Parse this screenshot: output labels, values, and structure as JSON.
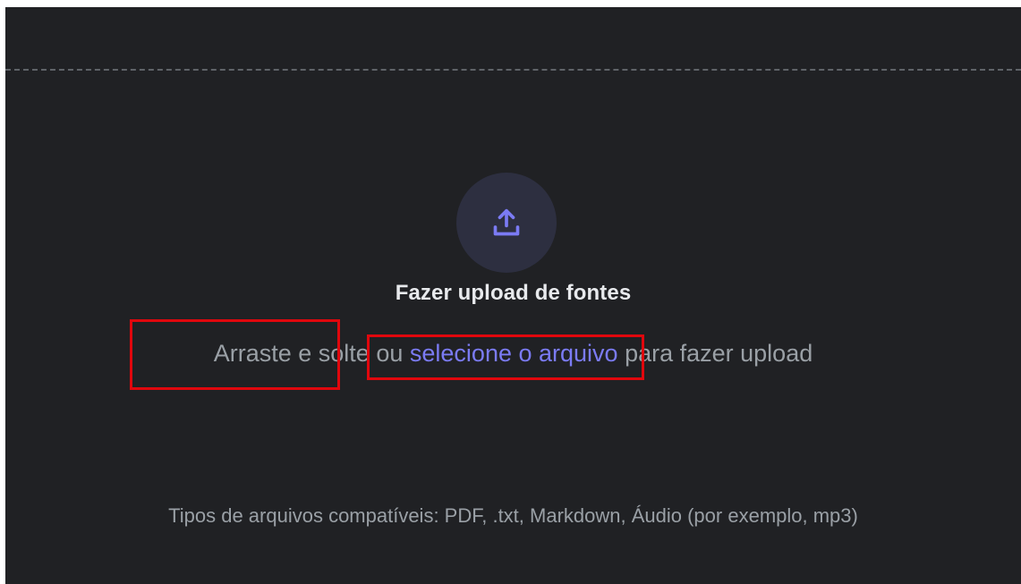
{
  "upload_area": {
    "icon": "upload-icon",
    "title": "Fazer upload de fontes",
    "instruction": {
      "prefix": "Arraste e solte",
      "connector": "ou",
      "link_label": "selecione o arquivo",
      "suffix": "para fazer upload"
    },
    "supported_types": "Tipos de arquivos compatíveis: PDF, .txt, Markdown, Áudio (por exemplo, mp3)"
  },
  "colors": {
    "background": "#202124",
    "accent": "#7b7bf4",
    "highlight": "#e0070d"
  }
}
